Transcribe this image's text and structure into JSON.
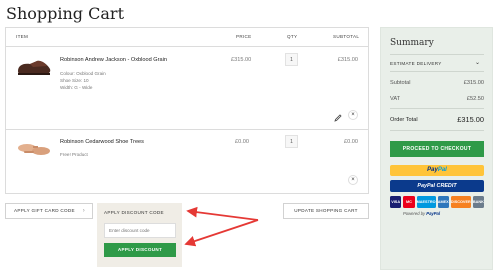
{
  "page": {
    "title": "Shopping Cart"
  },
  "table": {
    "headers": {
      "item": "ITEM",
      "price": "PRICE",
      "qty": "QTY",
      "subtotal": "SUBTOTAL"
    }
  },
  "items": [
    {
      "name": "Robinson Andrew Jackson - Oxblood Grain",
      "meta": [
        "Colour: Oxblood Grain",
        "Shoe Size: 10",
        "Width: G - Wide"
      ],
      "price": "£315.00",
      "qty": "1",
      "subtotal": "£315.00",
      "image": "oxblood-shoe"
    },
    {
      "name": "Robinson Cedarwood Shoe Trees",
      "meta": [
        "Free! Product"
      ],
      "price": "£0.00",
      "qty": "1",
      "subtotal": "£0.00",
      "image": "cedar-shoe-trees"
    }
  ],
  "icons": {
    "edit": "pencil-icon",
    "remove": "×",
    "chevron": "›"
  },
  "actions": {
    "gift_card": "APPLY GIFT CARD CODE",
    "gift_chevron": "›",
    "discount_tab": "APPLY DISCOUNT CODE",
    "update_cart": "UPDATE SHOPPING CART"
  },
  "discount": {
    "placeholder": "Enter discount code",
    "apply": "APPLY DISCOUNT"
  },
  "summary": {
    "title": "Summary",
    "estimate": "ESTIMATE DELIVERY",
    "estimate_chevron": "⌄",
    "subtotal_label": "Subtotal",
    "subtotal_value": "£315.00",
    "vat_label": "VAT",
    "vat_value": "£52.50",
    "total_label": "Order Total",
    "total_value": "£315.00",
    "checkout": "PROCEED TO CHECKOUT",
    "paypal_1": "Pay",
    "paypal_2": "Pal",
    "paypal_credit": "PayPal CREDIT",
    "cards": [
      "VISA",
      "MC",
      "MAESTRO",
      "AMEX",
      "DISCOVER",
      "BANK"
    ],
    "powered_prefix": "Powered by",
    "powered_brand": "PayPal"
  },
  "colors": {
    "accent_green": "#2f9a48",
    "annotation_red": "#e53935",
    "summary_bg": "#e9efe9",
    "paypal_yellow": "#ffc439"
  }
}
